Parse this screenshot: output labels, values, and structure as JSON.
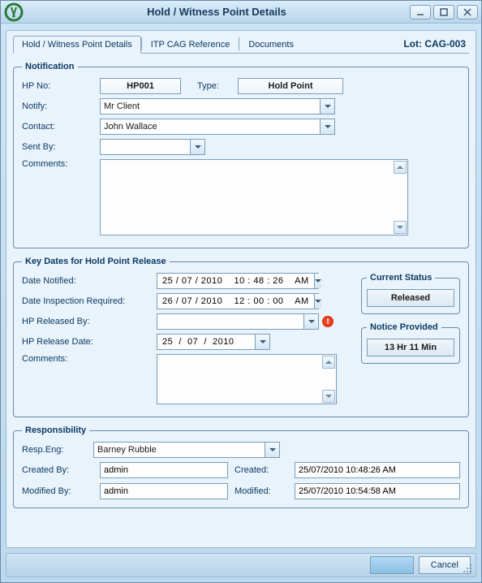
{
  "window": {
    "title": "Hold / Witness Point Details"
  },
  "tabs": [
    {
      "label": "Hold / Witness Point Details"
    },
    {
      "label": "ITP CAG Reference"
    },
    {
      "label": "Documents"
    }
  ],
  "lot": "Lot: CAG-003",
  "notification": {
    "legend": "Notification",
    "hp_no_label": "HP No:",
    "hp_no_value": "HP001",
    "type_label": "Type:",
    "type_value": "Hold Point",
    "notify_label": "Notify:",
    "notify_value": "Mr Client",
    "contact_label": "Contact:",
    "contact_value": "John Wallace",
    "sent_by_label": "Sent By:",
    "sent_by_value": "",
    "comments_label": "Comments:",
    "comments_value": ""
  },
  "keydates": {
    "legend": "Key Dates for Hold Point Release",
    "date_notified_label": "Date Notified:",
    "date_notified_value": "25 / 07 / 2010    10 : 48 : 26    AM",
    "date_insp_label": "Date Inspection Required:",
    "date_insp_value": "26 / 07 / 2010    12 : 00 : 00    AM",
    "released_by_label": "HP Released By:",
    "released_by_value": "",
    "release_date_label": "HP Release Date:",
    "release_date_value": "25  /  07  /  2010",
    "comments_label": "Comments:",
    "comments_value": "",
    "status_legend": "Current Status",
    "status_value": "Released",
    "notice_legend": "Notice Provided",
    "notice_value": "13 Hr 11 Min"
  },
  "responsibility": {
    "legend": "Responsibility",
    "resp_eng_label": "Resp.Eng:",
    "resp_eng_value": "Barney Rubble",
    "created_by_label": "Created By:",
    "created_by_value": "admin",
    "created_label": "Created:",
    "created_value": "25/07/2010 10:48:26 AM",
    "modified_by_label": "Modified By:",
    "modified_by_value": "admin",
    "modified_label": "Modified:",
    "modified_value": "25/07/2010 10:54:58 AM"
  },
  "footer": {
    "ok_label": "",
    "cancel_label": "Cancel"
  }
}
